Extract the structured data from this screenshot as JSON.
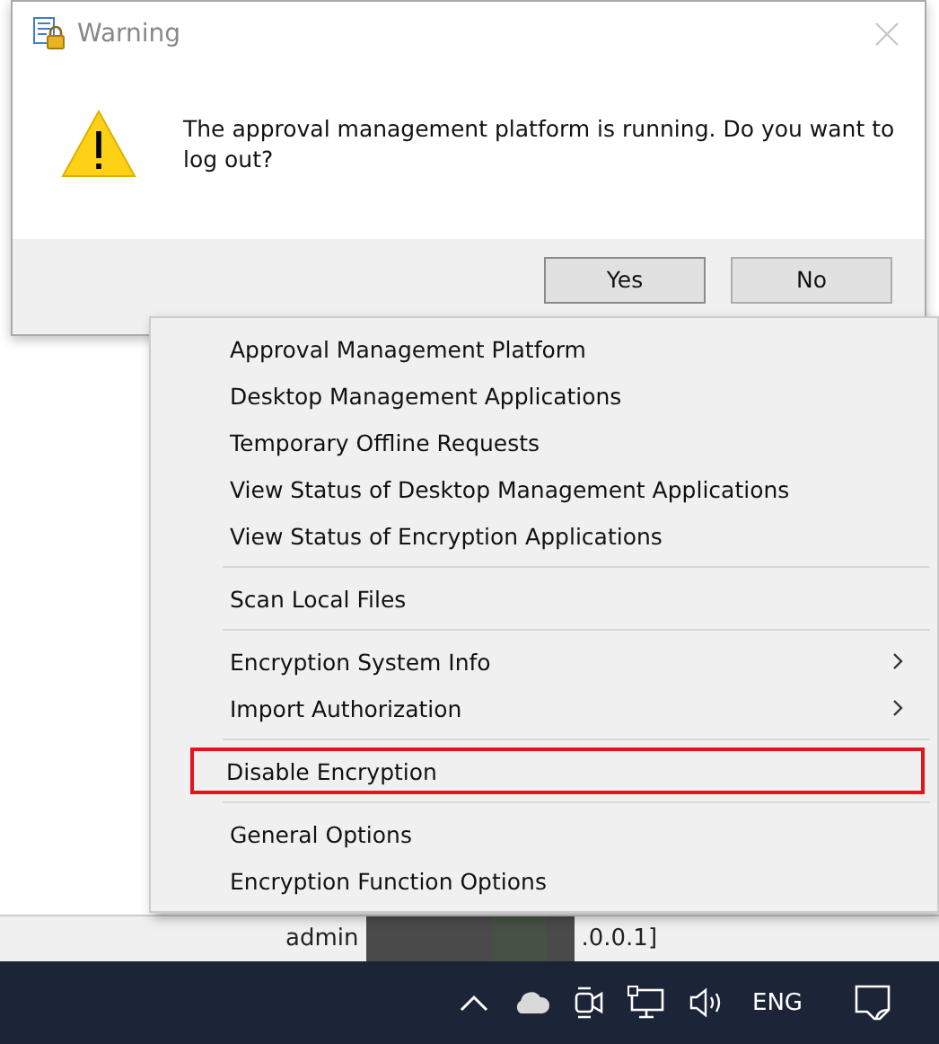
{
  "dialog": {
    "title": "Warning",
    "message": "The approval management platform is running. Do you want to log out?",
    "buttons": [
      {
        "label": "Yes",
        "selected": true
      },
      {
        "label": "No",
        "selected": false
      }
    ]
  },
  "context_menu": {
    "items": [
      {
        "kind": "item",
        "label": "Approval Management Platform",
        "submenu": false,
        "highlighted": false
      },
      {
        "kind": "item",
        "label": "Desktop Management Applications",
        "submenu": false,
        "highlighted": false
      },
      {
        "kind": "item",
        "label": "Temporary Offline Requests",
        "submenu": false,
        "highlighted": false
      },
      {
        "kind": "item",
        "label": "View Status of Desktop Management Applications",
        "submenu": false,
        "highlighted": false
      },
      {
        "kind": "item",
        "label": "View Status of Encryption Applications",
        "submenu": false,
        "highlighted": false
      },
      {
        "kind": "separator"
      },
      {
        "kind": "item",
        "label": "Scan Local Files",
        "submenu": false,
        "highlighted": false
      },
      {
        "kind": "separator"
      },
      {
        "kind": "item",
        "label": "Encryption System Info",
        "submenu": true,
        "highlighted": false
      },
      {
        "kind": "item",
        "label": "Import Authorization",
        "submenu": true,
        "highlighted": false
      },
      {
        "kind": "separator"
      },
      {
        "kind": "item",
        "label": "Disable Encryption",
        "submenu": false,
        "highlighted": true
      },
      {
        "kind": "separator"
      },
      {
        "kind": "item",
        "label": "General Options",
        "submenu": false,
        "highlighted": false
      },
      {
        "kind": "item",
        "label": "Encryption Function Options",
        "submenu": false,
        "highlighted": false
      }
    ]
  },
  "background_row": {
    "cells": [
      "admin",
      ".0.0.1]"
    ]
  },
  "taskbar": {
    "language": "ENG"
  }
}
